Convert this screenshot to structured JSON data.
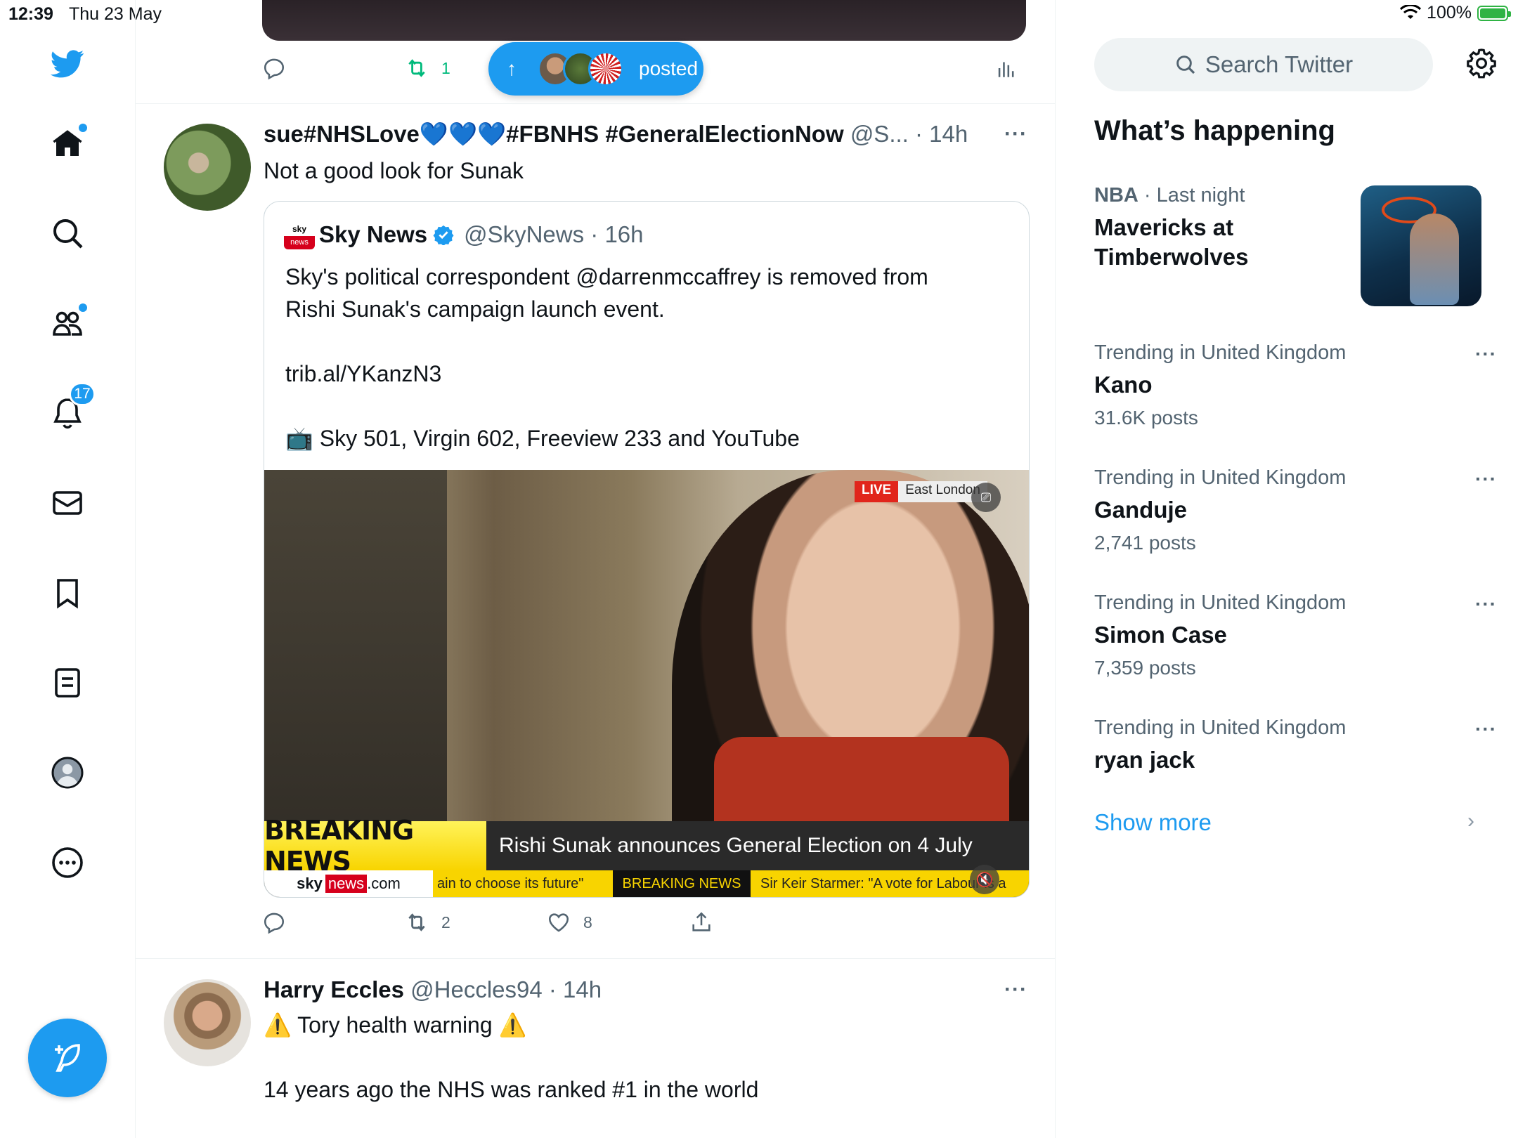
{
  "status_bar": {
    "time": "12:39",
    "date": "Thu 23 May",
    "grabber": "•••",
    "wifi": "wifi-icon",
    "battery_text": "100%",
    "battery_level": 1.0
  },
  "left_nav": {
    "logo": "twitter-bird-icon",
    "items": [
      {
        "name": "home",
        "icon": "home-icon",
        "has_dot": true
      },
      {
        "name": "explore",
        "icon": "search-icon"
      },
      {
        "name": "communities",
        "icon": "communities-icon",
        "has_dot": true
      },
      {
        "name": "notifications",
        "icon": "bell-icon",
        "badge": "17"
      },
      {
        "name": "messages",
        "icon": "mail-icon"
      },
      {
        "name": "bookmarks",
        "icon": "bookmark-icon"
      },
      {
        "name": "lists",
        "icon": "list-icon"
      },
      {
        "name": "profile",
        "icon": "profile-icon"
      },
      {
        "name": "more",
        "icon": "more-circle-icon"
      }
    ],
    "compose": "compose-feather-icon"
  },
  "timeline": {
    "top_actions": {
      "retweet_count": "1"
    },
    "posted_pill": {
      "arrow": "↑",
      "label": "posted"
    },
    "tweet1": {
      "display_name": "sue#NHSLove💙💙💙#FBNHS #GeneralElectionNow",
      "handle_time": "@S... · 14h",
      "more": "···",
      "text": "Not a good look for Sunak",
      "quote": {
        "logo_top": "sky",
        "logo_bottom": "news",
        "name": "Sky News",
        "verified": "verified-badge-icon",
        "handle_time": "@SkyNews · 16h",
        "text": "Sky's political correspondent @darrenmccaffrey is removed from\nRishi Sunak's campaign launch event.\n\ntrib.al/YKanzN3\n\n📺 Sky 501, Virgin 602, Freeview 233 and YouTube",
        "media": {
          "live": "LIVE",
          "location": "East London",
          "breaking": "BREAKING NEWS",
          "headline": "Rishi Sunak announces General Election on 4 July",
          "ticker_brand_sky": "sky",
          "ticker_brand_news": "news",
          "ticker_brand_com": ".com",
          "ticker_1": "ain to choose its future\"",
          "ticker_2": "BREAKING NEWS",
          "ticker_3": "Sir Keir Starmer: \"A vote for Labour is a"
        }
      },
      "actions": {
        "reply": "",
        "retweets": "2",
        "likes": "8"
      }
    },
    "tweet2": {
      "display_name": "Harry Eccles",
      "handle_time": "@Heccles94 · 14h",
      "more": "···",
      "text": "⚠️ Tory health warning ⚠️\n\n14 years ago the NHS was ranked #1 in the world"
    }
  },
  "right_panel": {
    "search_placeholder": "Search Twitter",
    "section_title": "What’s happening",
    "featured": {
      "category": "NBA",
      "time": "· Last night",
      "title": "Mavericks at Timberwolves"
    },
    "trends": [
      {
        "context": "Trending in United Kingdom",
        "topic": "Kano",
        "count": "31.6K posts"
      },
      {
        "context": "Trending in United Kingdom",
        "topic": "Ganduje",
        "count": "2,741 posts"
      },
      {
        "context": "Trending in United Kingdom",
        "topic": "Simon Case",
        "count": "7,359 posts"
      },
      {
        "context": "Trending in United Kingdom",
        "topic": "ryan jack",
        "count": ""
      }
    ],
    "trend_more": "···",
    "show_more": "Show more"
  },
  "colors": {
    "accent": "#1d9bf0",
    "retweet_green": "#00ba7c",
    "secondary_text": "#536471"
  }
}
